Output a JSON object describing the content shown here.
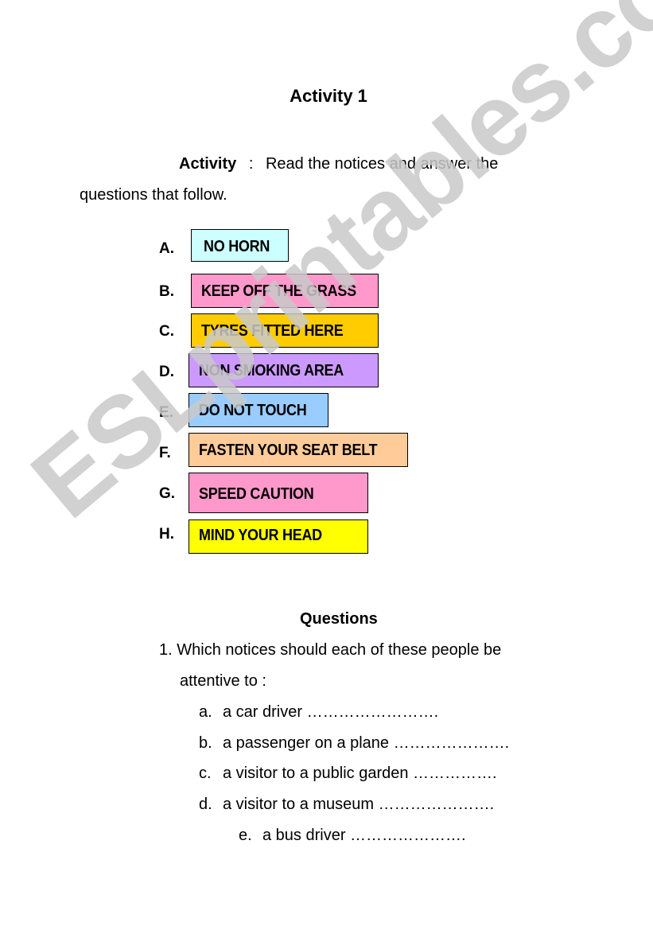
{
  "title": "Activity 1",
  "intro": {
    "label": "Activity",
    "separator": ":",
    "text_line1": "Read the notices and answer the",
    "text_line2": "questions that follow."
  },
  "notices": [
    {
      "letter": "A.",
      "text": "NO HORN",
      "color": "#ccffff"
    },
    {
      "letter": "B.",
      "text": "KEEP OFF THE GRASS",
      "color": "#ff99cc"
    },
    {
      "letter": "C.",
      "text": "TYRES FITTED HERE",
      "color": "#ffcc00"
    },
    {
      "letter": "D.",
      "text": "NON  SMOKING AREA",
      "color": "#cc99ff"
    },
    {
      "letter": "E.",
      "text": "DO NOT TOUCH",
      "color": "#99ccff"
    },
    {
      "letter": "F.",
      "text": "FASTEN YOUR SEAT BELT",
      "color": "#ffcc99"
    },
    {
      "letter": "G.",
      "text": "SPEED CAUTION",
      "color": "#ff99cc"
    },
    {
      "letter": "H.",
      "text": "MIND YOUR HEAD",
      "color": "#ffff00"
    }
  ],
  "questions": {
    "heading": "Questions",
    "q1_number": "1.",
    "q1_line1": "Which notices should each of these people be",
    "q1_line2": "attentive to :",
    "items": [
      {
        "letter": "a.",
        "text": "a car driver ……………………."
      },
      {
        "letter": "b.",
        "text": "a passenger on a plane …………………."
      },
      {
        "letter": "c.",
        "text": "a visitor to a public garden ……………."
      },
      {
        "letter": "d.",
        "text": "a visitor to a museum …………………."
      },
      {
        "letter": "e.",
        "text": "a bus driver …………………."
      }
    ]
  },
  "watermark": "ESLprintables.com"
}
